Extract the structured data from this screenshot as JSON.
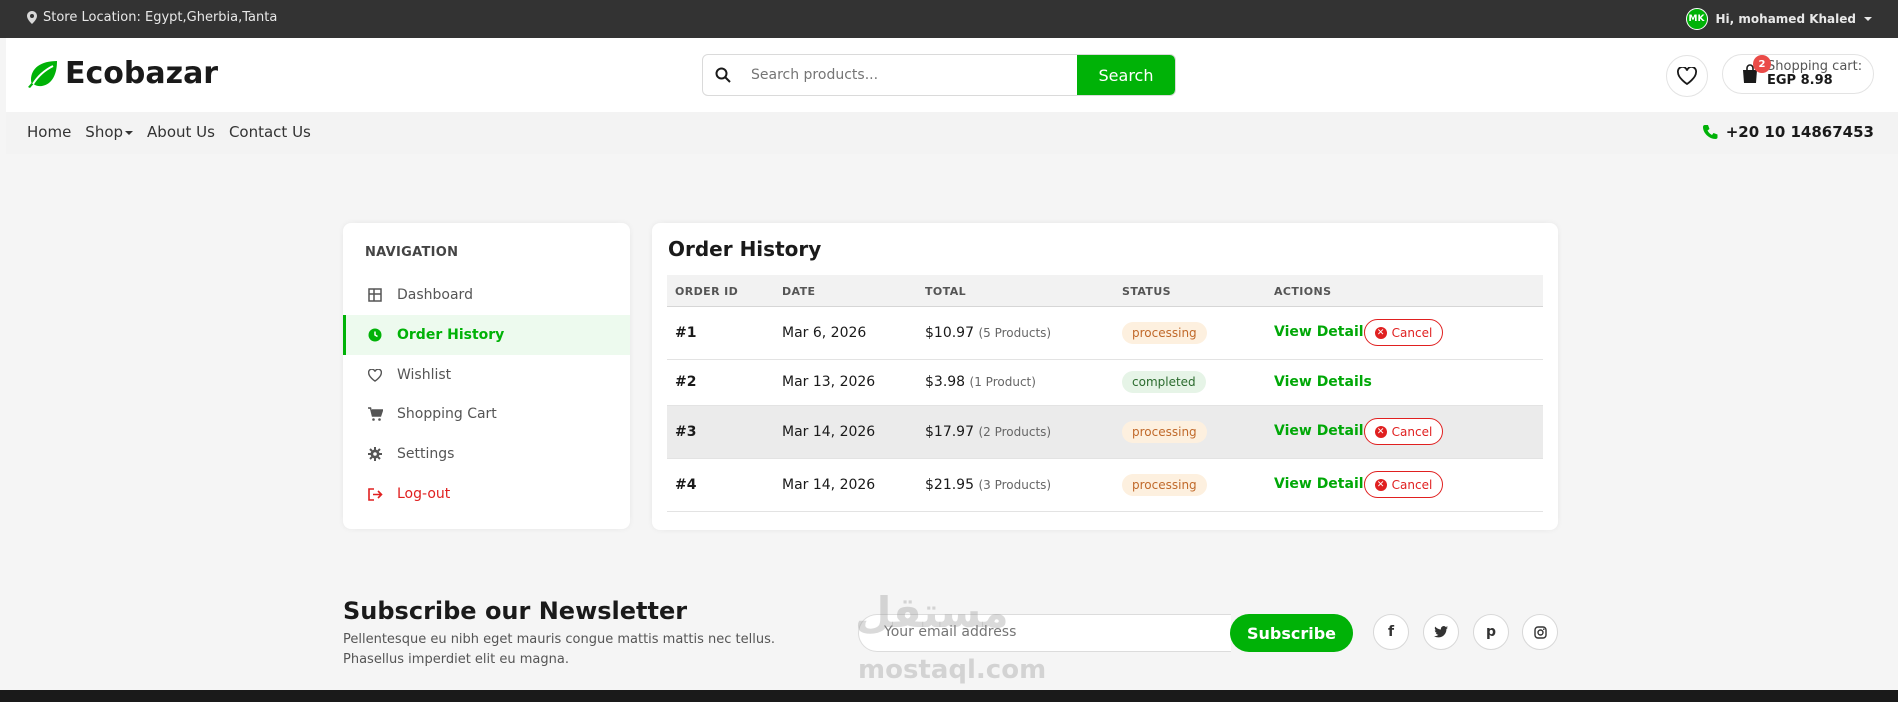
{
  "topbar": {
    "location": "Store Location: Egypt,Gherbia,Tanta",
    "avatar": "MK",
    "greeting": "Hi, mohamed Khaled"
  },
  "header": {
    "brand": "Ecobazar",
    "search_placeholder": "Search products...",
    "search_button": "Search",
    "cart_count": "2",
    "cart_label": "Shopping cart:",
    "cart_total": "EGP 8.98"
  },
  "nav": {
    "links": [
      "Home",
      "Shop",
      "About Us",
      "Contact Us"
    ],
    "phone": "+20 10 14867453"
  },
  "sidebar": {
    "title": "NAVIGATION",
    "items": [
      {
        "label": "Dashboard",
        "icon": "dashboard-icon"
      },
      {
        "label": "Order History",
        "icon": "history-icon"
      },
      {
        "label": "Wishlist",
        "icon": "heart-icon"
      },
      {
        "label": "Shopping Cart",
        "icon": "cart-icon"
      },
      {
        "label": "Settings",
        "icon": "gear-icon"
      },
      {
        "label": "Log-out",
        "icon": "logout-icon"
      }
    ],
    "active_item": "Order History"
  },
  "orders": {
    "title": "Order History",
    "columns": [
      "ORDER ID",
      "DATE",
      "TOTAL",
      "STATUS",
      "ACTIONS"
    ],
    "rows": [
      {
        "id": "#1",
        "date": "Mar 6, 2026",
        "total": "$10.97",
        "qty": "(5 Products)",
        "status": "processing",
        "view": "View Details",
        "cancel": "Cancel"
      },
      {
        "id": "#2",
        "date": "Mar 13, 2026",
        "total": "$3.98",
        "qty": "(1 Product)",
        "status": "completed",
        "view": "View Details",
        "cancel": ""
      },
      {
        "id": "#3",
        "date": "Mar 14, 2026",
        "total": "$17.97",
        "qty": "(2 Products)",
        "status": "processing",
        "view": "View Details",
        "cancel": "Cancel"
      },
      {
        "id": "#4",
        "date": "Mar 14, 2026",
        "total": "$21.95",
        "qty": "(3 Products)",
        "status": "processing",
        "view": "View Details",
        "cancel": "Cancel"
      }
    ]
  },
  "newsletter": {
    "title": "Subscribe our Newsletter",
    "description": "Pellentesque eu nibh eget mauris congue mattis mattis nec tellus. Phasellus imperdiet elit eu magna.",
    "email_placeholder": "Your email address",
    "subscribe_button": "Subscribe",
    "social": [
      "f",
      "t",
      "p",
      "ig"
    ]
  },
  "watermark": {
    "arabic": "مستقل",
    "latin": "mostaql.com"
  },
  "colors": {
    "primary": "#00b207",
    "topbar": "#333333",
    "danger": "#e02020",
    "processing_bg": "#fdf0df",
    "completed_bg": "#e6f4e7"
  }
}
